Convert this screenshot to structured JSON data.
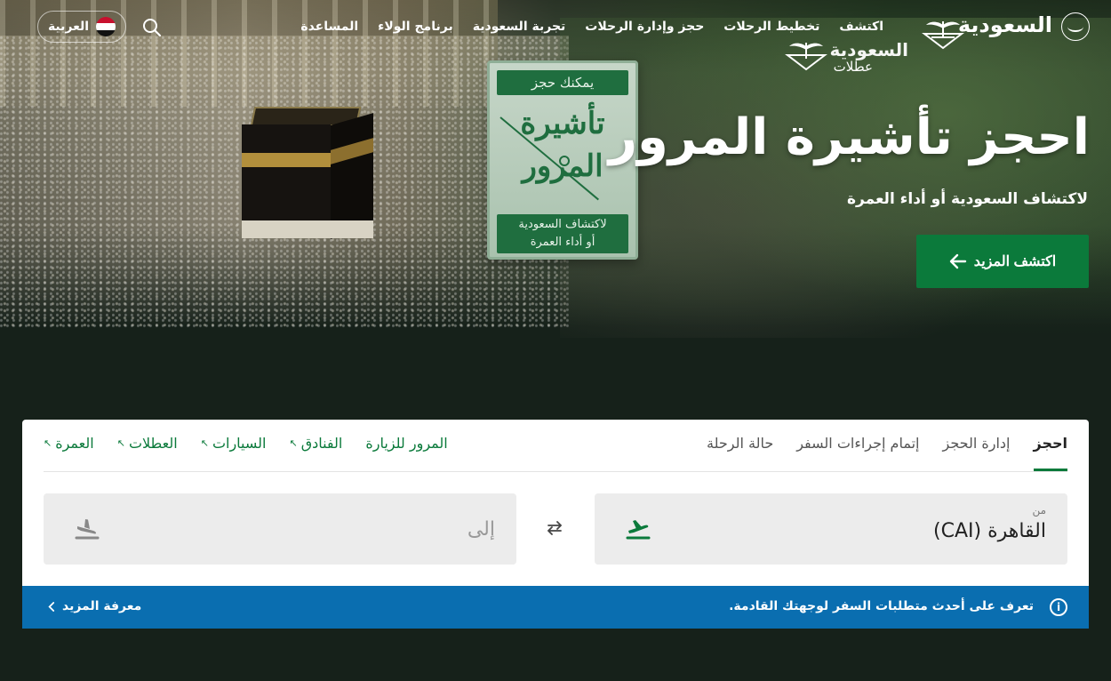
{
  "nav": {
    "brand": "السعودية",
    "links": [
      "اكتشف",
      "تخطيط الرحلات",
      "حجز وإدارة الرحلات",
      "تجربة السعودية",
      "برنامج الولاء",
      "المساعدة"
    ],
    "language": "العربية"
  },
  "holidays_logo": {
    "brand": "السعودية",
    "label": "عطلات"
  },
  "signboard": {
    "top": "يمكنك حجز",
    "big_line1": "تأشيرة",
    "big_line2": "المرور",
    "bottom_line1": "لاكتشاف السعودية",
    "bottom_line2": "أو أداء العمرة"
  },
  "hero": {
    "title": "احجز تأشيرة المرور",
    "subtitle": "لاكتشاف السعودية أو أداء العمرة",
    "cta": "اكتشف المزيد"
  },
  "booking": {
    "tabs": [
      "احجز",
      "إدارة الحجز",
      "إتمام إجراءات السفر",
      "حالة الرحلة"
    ],
    "active_tab": "احجز",
    "external_links": [
      "المرور للزيارة",
      "الفنادق",
      "السيارات",
      "العطلات",
      "العمرة"
    ],
    "from": {
      "label": "من",
      "value": "القاهرة (CAI)"
    },
    "to": {
      "placeholder": "إلى"
    }
  },
  "info_bar": {
    "message": "تعرف على أحدث متطلبات السفر لوجهتك القادمة.",
    "more": "معرفة المزيد"
  },
  "colors": {
    "accent": "#0b7a3b",
    "info": "#0a6eb0",
    "page_bg": "#16211a"
  }
}
